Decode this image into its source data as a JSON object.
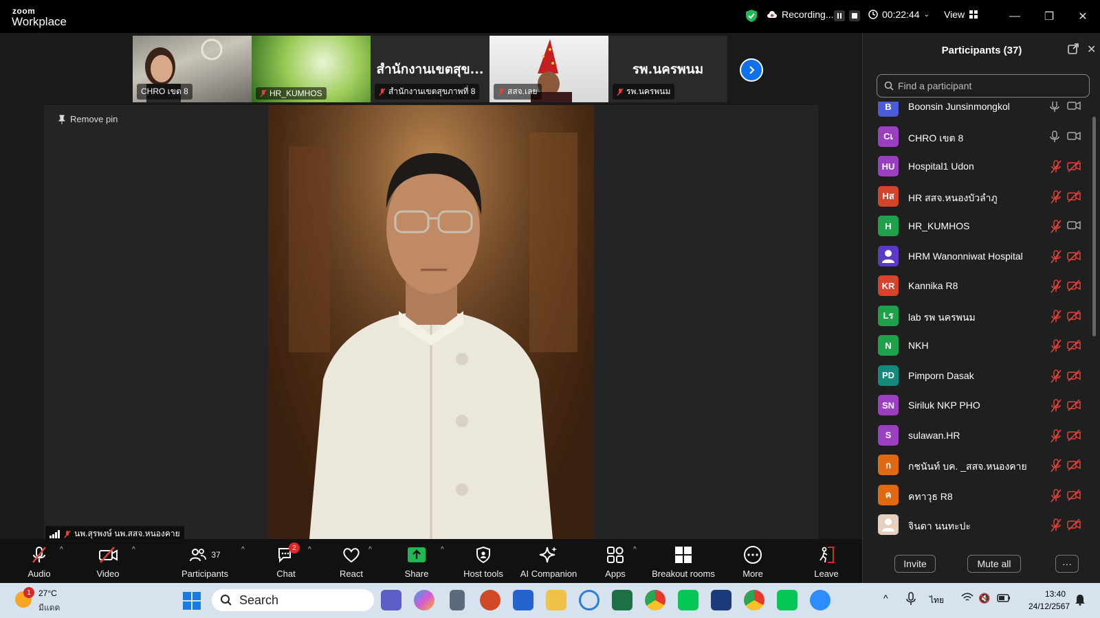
{
  "titlebar": {
    "logo_top": "zoom",
    "logo_bottom": "Workplace",
    "recording_label": "Recording...",
    "timer": "00:22:44",
    "view_label": "View"
  },
  "thumbnails": [
    {
      "label": "CHRO เขต 8",
      "title": ""
    },
    {
      "label": "HR_KUMHOS",
      "title": ""
    },
    {
      "label": "สำนักงานเขตสุขภาพที่ 8",
      "title": "สำนักงานเขตสุข..."
    },
    {
      "label": "สสจ.เลย",
      "title": ""
    },
    {
      "label": "รพ.นครพนม",
      "title": "รพ.นครพนม"
    }
  ],
  "stage": {
    "remove_pin": "Remove pin",
    "speaker_name": "นพ.สุรพงษ์ นพ.สสจ.หนองคาย"
  },
  "toolbar": {
    "audio": "Audio",
    "video": "Video",
    "participants": "Participants",
    "participants_count": "37",
    "chat": "Chat",
    "chat_badge": "2",
    "react": "React",
    "share": "Share",
    "host_tools": "Host tools",
    "ai_companion": "AI Companion",
    "apps": "Apps",
    "breakout": "Breakout rooms",
    "more": "More",
    "leave": "Leave"
  },
  "panel": {
    "title": "Participants (37)",
    "search_placeholder": "Find a participant",
    "invite": "Invite",
    "mute_all": "Mute all",
    "participants": [
      {
        "initials": "B",
        "name": "Boonsin Junsinmongkol",
        "color": "#4b5bd6",
        "muted": false,
        "cam": false
      },
      {
        "initials": "Cเ",
        "name": "CHRO เขต 8",
        "color": "#9b3fc1",
        "muted": false,
        "cam": false
      },
      {
        "initials": "HU",
        "name": "Hospital1 Udon",
        "color": "#9b3fc1",
        "muted": true,
        "cam": true
      },
      {
        "initials": "Hส",
        "name": "HR  สสจ.หนองบัวลำภู",
        "color": "#d4432c",
        "muted": true,
        "cam": true
      },
      {
        "initials": "H",
        "name": "HR_KUMHOS",
        "color": "#1fa04a",
        "muted": true,
        "cam": false
      },
      {
        "initials": "",
        "name": "HRM Wanonniwat Hospital",
        "color": "#5b39c9",
        "muted": true,
        "cam": true
      },
      {
        "initials": "KR",
        "name": "Kannika R8",
        "color": "#d4432c",
        "muted": true,
        "cam": true
      },
      {
        "initials": "Lร",
        "name": "lab รพ นครพนม",
        "color": "#1fa04a",
        "muted": true,
        "cam": true
      },
      {
        "initials": "N",
        "name": "NKH",
        "color": "#1fa04a",
        "muted": true,
        "cam": true
      },
      {
        "initials": "PD",
        "name": "Pimporn Dasak",
        "color": "#138a7c",
        "muted": true,
        "cam": true
      },
      {
        "initials": "SN",
        "name": "Siriluk NKP PHO",
        "color": "#9b3fc1",
        "muted": true,
        "cam": true
      },
      {
        "initials": "S",
        "name": "sulawan.HR",
        "color": "#9b3fc1",
        "muted": true,
        "cam": true
      },
      {
        "initials": "ก",
        "name": "กชนันท์ บค. _สสจ.หนองคาย",
        "color": "#e06a12",
        "muted": true,
        "cam": true
      },
      {
        "initials": "ค",
        "name": "คทาวุธ R8",
        "color": "#e06a12",
        "muted": true,
        "cam": true
      },
      {
        "initials": "",
        "name": "จินดา นนทะปะ",
        "color": "#e8d0c0",
        "muted": true,
        "cam": true
      }
    ]
  },
  "taskbar": {
    "weather_badge": "1",
    "weather_temp": "27°C",
    "weather_desc": "มีแดด",
    "search": "Search",
    "lang": "ไทย",
    "time": "13:40",
    "date": "24/12/2567"
  },
  "colors": {
    "accent": "#0e71eb",
    "share_green": "#1fb855",
    "leave_red": "#e02828",
    "muted_red": "#e0433a"
  }
}
